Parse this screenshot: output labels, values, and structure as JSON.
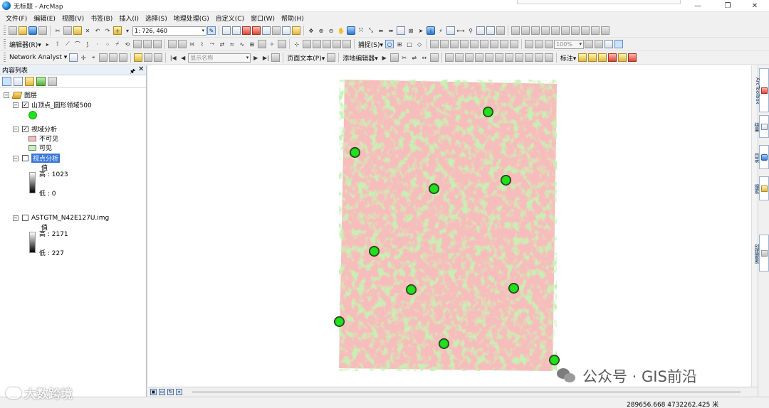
{
  "window": {
    "title": "无标题 - ArcMap",
    "min": "—",
    "max": "❐",
    "close": "✕"
  },
  "menu": [
    "文件(F)",
    "编辑(E)",
    "视图(V)",
    "书签(B)",
    "插入(I)",
    "选择(S)",
    "地理处理(G)",
    "自定义(C)",
    "窗口(W)",
    "帮助(H)"
  ],
  "toolbar": {
    "scale_value": "1: 726, 460",
    "editor_label": "编辑器(R)▾",
    "network_analyst_label": "Network Analyst ▾",
    "snapping_label": "捕捉(S)▾",
    "display_field": "显示名称",
    "page_text_label": "页面文本(P)▾",
    "georef_label": "添地编辑器▾",
    "zoom_percent": "100%",
    "annotation_label": "标注▾"
  },
  "toc": {
    "title": "内容列表",
    "pin": "🖈",
    "close": "✕",
    "root_label": "图层",
    "layers": [
      {
        "name": "山顶点_圆形领域500",
        "checked": true
      },
      {
        "name": "视域分析",
        "checked": true,
        "classes": [
          {
            "label": "不可见",
            "color": "#f7bcbc"
          },
          {
            "label": "可见",
            "color": "#c4f2b3"
          }
        ]
      },
      {
        "name": "视点分析",
        "checked": false,
        "value_title": "值",
        "high": "高 : 1023",
        "low": "低 : 0"
      },
      {
        "name": "ASTGTM_N42E127U.img",
        "checked": false,
        "value_title": "值",
        "high": "高 : 2171",
        "low": "低 : 227"
      }
    ]
  },
  "map": {
    "background": "#ffffff",
    "invisible_color": "#f7bcbc",
    "visible_color": "#c4f2b3",
    "point_color": "#22e01a"
  },
  "dock": [
    "ArcToolbox",
    "结果",
    "目录",
    "搜索",
    "创建要素"
  ],
  "status": {
    "coordinates": "289656.668  4732262.425 米"
  },
  "watermarks": {
    "left": "大数跨境",
    "right": "公众号 · GIS前沿"
  }
}
